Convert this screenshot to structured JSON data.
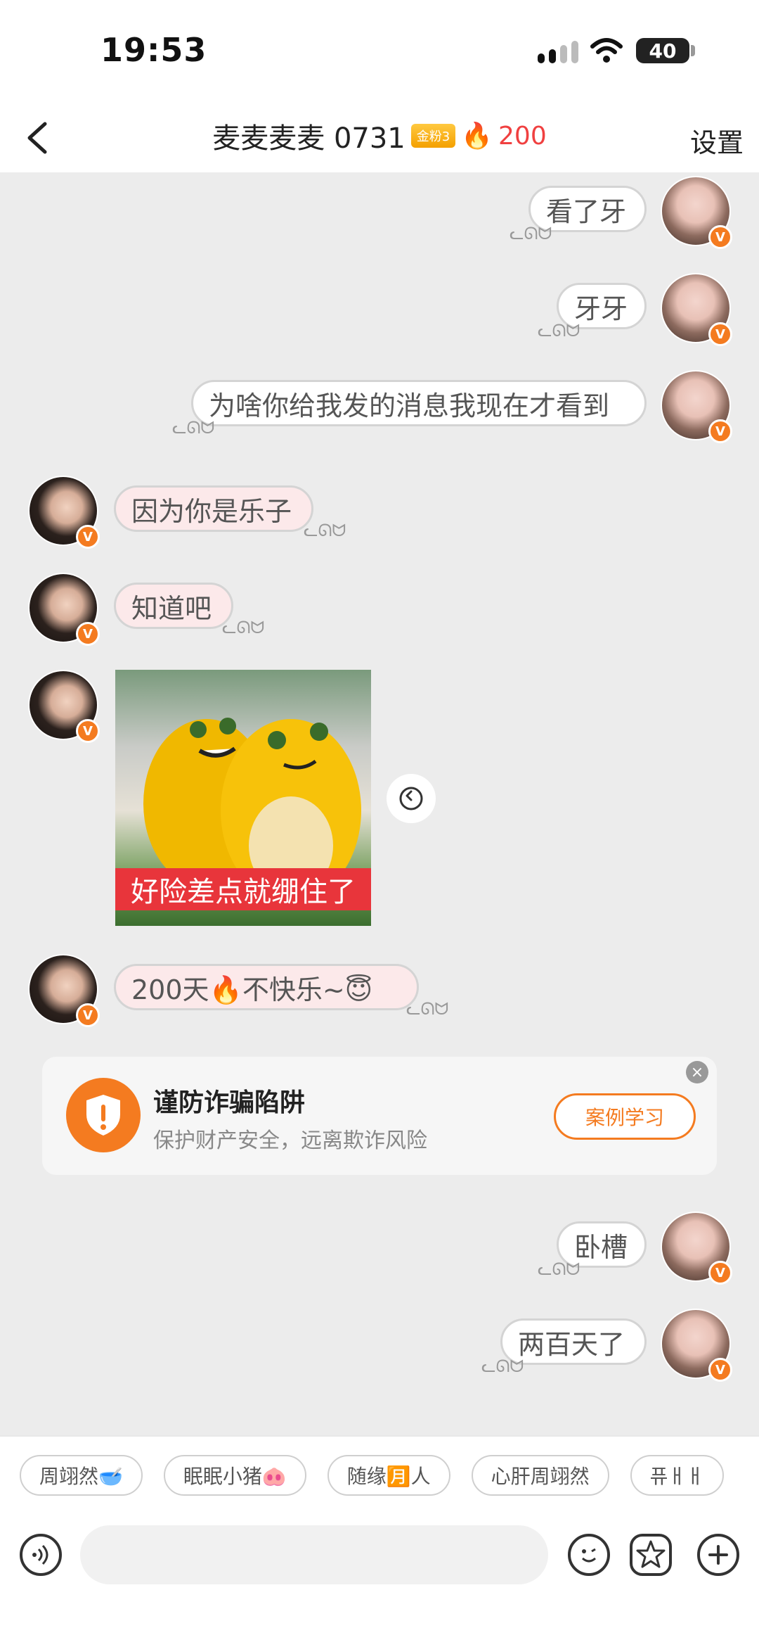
{
  "status": {
    "time": "19:53",
    "battery": "40"
  },
  "header": {
    "title": "麦麦麦麦 0731",
    "fan_badge": "金粉3",
    "streak_count": "200",
    "settings_label": "设置"
  },
  "messages": [
    {
      "side": "out",
      "text": "看了牙"
    },
    {
      "side": "out",
      "text": "牙牙"
    },
    {
      "side": "out",
      "text": "为啥你给我发的消息我现在才看到"
    },
    {
      "side": "in",
      "text": "因为你是乐子"
    },
    {
      "side": "in",
      "text": "知道吧"
    },
    {
      "side": "in",
      "type": "sticker",
      "caption": "好险差点就绷住了"
    },
    {
      "side": "in",
      "text": "200天🔥不快乐~😇"
    },
    {
      "side": "out",
      "text": "卧槽"
    },
    {
      "side": "out",
      "text": "两百天了"
    }
  ],
  "fraud_notice": {
    "title": "谨防诈骗陷阱",
    "subtitle": "保护财产安全，远离欺诈风险",
    "button": "案例学习"
  },
  "quick_chips": [
    "周翊然🥣",
    "眠眠小猪🐽",
    "随缘🈷️人",
    "心肝周翊然",
    "퓨ㅐㅐ"
  ],
  "colors": {
    "accent": "#f47b20",
    "incoming_bubble": "#fce9ea",
    "chat_bg": "#ececec"
  }
}
